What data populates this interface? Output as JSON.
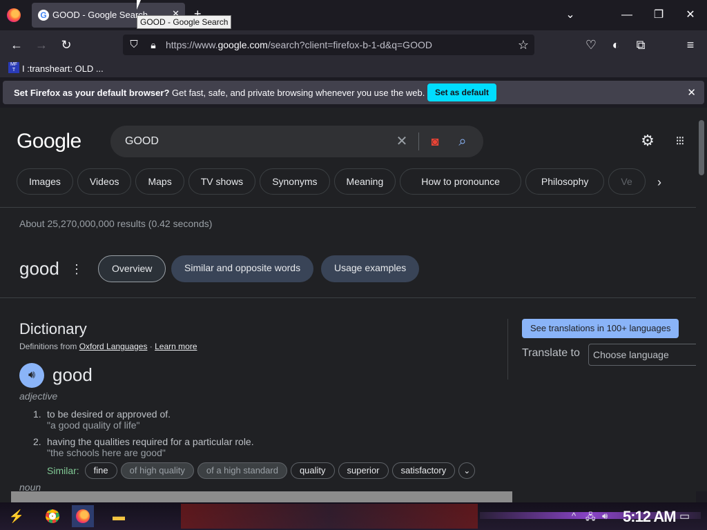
{
  "browser": {
    "tab_title": "GOOD - Google Search",
    "tooltip": "GOOD - Google Search",
    "url_prefix": "https://www.",
    "url_domain": "google.com",
    "url_rest": "/search?client=firefox-b-1-d&q=GOOD",
    "bookmark_label": "I :transheart: OLD ...",
    "bookmark_icon_text": "MF T",
    "notice_bold": "Set Firefox as your default browser?",
    "notice_text": " Get fast, safe, and private browsing whenever you use the web.",
    "notice_button": "Set as default"
  },
  "google": {
    "logo": "Google",
    "query": "GOOD",
    "chips": [
      "Images",
      "Videos",
      "Maps",
      "TV shows",
      "Synonyms",
      "Meaning",
      "How to pronounce",
      "Philosophy",
      "Ve"
    ],
    "results_count": "About 25,270,000,000 results (0.42 seconds)",
    "word_heading": "good",
    "tabs": [
      "Overview",
      "Similar and opposite words",
      "Usage examples"
    ]
  },
  "dictionary": {
    "title": "Dictionary",
    "definitions_from": "Definitions from ",
    "source_link": "Oxford Languages",
    "separator": " · ",
    "learn_more": "Learn more",
    "word": "good",
    "part_of_speech": "adjective",
    "definitions": [
      {
        "num": "1.",
        "text": "to be desired or approved of.",
        "example": "\"a good quality of life\""
      },
      {
        "num": "2.",
        "text": "having the qualities required for a particular role.",
        "example": "\"the schools here are good\""
      }
    ],
    "similar_label": "Similar:",
    "similar": [
      "fine",
      "of high quality",
      "of a high standard",
      "quality",
      "superior",
      "satisfactory"
    ],
    "next_pos": "noun"
  },
  "translate": {
    "banner": "See translations in 100+ languages",
    "label": "Translate to",
    "select_placeholder": "Choose language"
  },
  "taskbar": {
    "clock": "5:12 AM"
  },
  "colors": {
    "accent_blue": "#8ab4f8",
    "firefox_cyan": "#00ddff",
    "similar_green": "#81c995"
  }
}
